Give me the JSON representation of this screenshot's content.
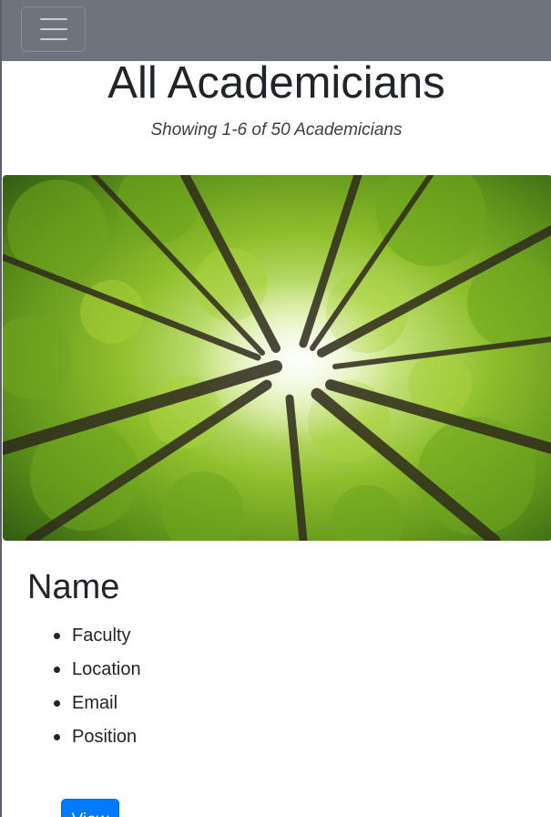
{
  "navbar": {
    "toggler_icon": "hamburger-icon",
    "background": "#6c757d"
  },
  "page": {
    "title": "All Academicians",
    "subtitle": "Showing 1-6 of 50 Academicians"
  },
  "card": {
    "image_subject": "forest-canopy",
    "title": "Name",
    "details": [
      "Faculty",
      "Location",
      "Email",
      "Position"
    ],
    "button_label": "View",
    "button_color": "#007bff"
  }
}
